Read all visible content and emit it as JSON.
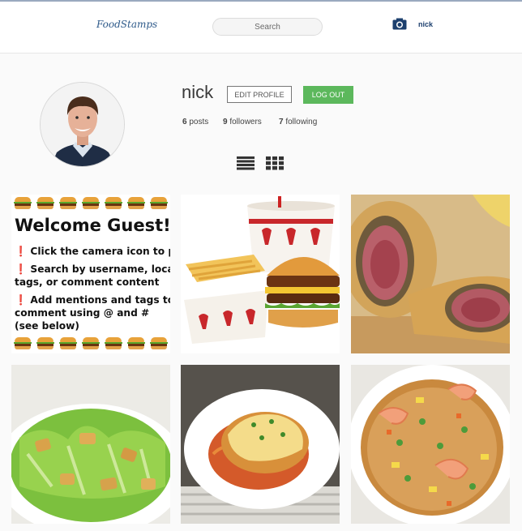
{
  "nav": {
    "logo": "FoodStamps",
    "search_placeholder": "Search",
    "camera_icon": "camera-icon",
    "username": "nick"
  },
  "profile": {
    "avatar_icon": "user-avatar",
    "username": "nick",
    "edit_label": "EDIT PROFILE",
    "logout_label": "LOG OUT",
    "posts_count": "6",
    "posts_label": "posts",
    "followers_count": "9",
    "followers_label": "followers",
    "following_count": "7",
    "following_label": "following"
  },
  "view_toggles": [
    "list-view-icon",
    "grid-view-icon"
  ],
  "posts": [
    {
      "type": "welcome",
      "title": "Welcome Guest!",
      "lines": [
        "❗ Click the camera icon to post",
        "❗ Search by username, location,",
        "tags, or comment content",
        "❗ Add mentions and tags to a",
        "comment using @ and #",
        "(see below)"
      ]
    },
    {
      "type": "photo",
      "subject": "burger-fries-drink"
    },
    {
      "type": "photo",
      "subject": "beef-wellington"
    },
    {
      "type": "photo",
      "subject": "caesar-salad"
    },
    {
      "type": "photo",
      "subject": "chicken-parmesan"
    },
    {
      "type": "photo",
      "subject": "shrimp-fried-rice"
    }
  ],
  "colors": {
    "accent_green": "#5cb85c",
    "brand_blue": "#1c3f6e"
  }
}
